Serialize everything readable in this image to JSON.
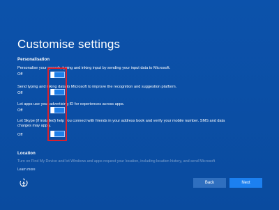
{
  "title": "Customise settings",
  "personalisation": {
    "heading": "Personalisation",
    "settings": [
      {
        "description": "Personalise your speech, typing and inking input by sending your input data to Microsoft.",
        "state": "Off",
        "on": false
      },
      {
        "description": "Send typing and inking data to Microsoft to improve the recognition and suggestion platform.",
        "state": "Off",
        "on": false
      },
      {
        "description": "Let apps use your advertising ID for experiences across apps.",
        "state": "Off",
        "on": false
      },
      {
        "description": "Let Skype (if installed) help you connect with friends in your address book and verify your mobile number. SMS and data charges may apply.",
        "state": "Off",
        "on": false
      }
    ]
  },
  "location": {
    "heading": "Location",
    "truncated_text": "Turn on Find My Device and let Windows and apps request your location, including location history, and send Microsoft"
  },
  "footer": {
    "learn_more": "Learn more",
    "back_label": "Back",
    "next_label": "Next",
    "accessibility_icon": "ease-of-access-icon"
  },
  "colors": {
    "background": "#0b4fa6",
    "toggle_fill": "#1d7ee8",
    "highlight_box": "#d8202e",
    "next_button": "#1c80f0",
    "back_button": "#2f6fbf"
  }
}
